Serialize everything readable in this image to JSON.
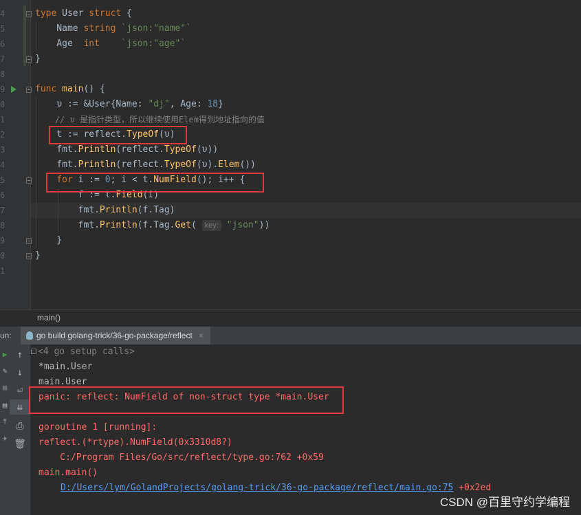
{
  "editor": {
    "line_numbers": [
      "4",
      "5",
      "6",
      "7",
      "8",
      "9",
      "0",
      "1",
      "2",
      "3",
      "4",
      "5",
      "6",
      "7",
      "8",
      "9",
      "0",
      "1"
    ],
    "line1": {
      "kw": "type",
      "name": " User ",
      "kw2": "struct",
      "rest": " {"
    },
    "line2": {
      "field": "    Name ",
      "type": "string",
      "tag": " `json:",
      "tagval": "\"name\"",
      "tagend": "`"
    },
    "line3": {
      "field": "    Age  ",
      "type": "int",
      "tag": "    `json:",
      "tagval": "\"age\"",
      "tagend": "`"
    },
    "line4": "}",
    "line6": {
      "kw": "func",
      "name": " main",
      "rest": "() {"
    },
    "line7": {
      "a": "    υ := &User{Name: ",
      "s": "\"dj\"",
      "b": ", Age: ",
      "n": "18",
      "c": "}"
    },
    "line8": "    // υ 是指针类型，所以继续使用Elem得到地址指向的值",
    "line9": {
      "a": "    t := ",
      "pkg": "reflect.",
      "fn": "TypeOf",
      "b": "(υ)"
    },
    "line10": {
      "a": "    fmt.",
      "fn": "Println",
      "b": "(reflect.",
      "fn2": "TypeOf",
      "c": "(υ))"
    },
    "line11": {
      "a": "    fmt.",
      "fn": "Println",
      "b": "(reflect.",
      "fn2": "TypeOf",
      "c": "(υ).",
      "fn3": "Elem",
      "d": "())"
    },
    "line12": {
      "kw": "    for",
      "a": " i := ",
      "n": "0",
      "b": "; i < t.",
      "fn": "NumField",
      "c": "(); i++ {"
    },
    "line13": {
      "a": "        f := t.",
      "fn": "Field",
      "b": "(i)"
    },
    "line14": {
      "a": "        fmt.",
      "fn": "Println",
      "b": "(f.Tag)"
    },
    "line15": {
      "a": "        fmt.",
      "fn": "Println",
      "b": "(f.Tag.",
      "fn2": "Get",
      "c": "( ",
      "hint": "key:",
      "s": " \"json\"",
      "d": "))"
    },
    "line16": "    }",
    "line17": "}"
  },
  "breadcrumb": "main()",
  "run": {
    "label": "un:",
    "tab_title": "go build golang-trick/36-go-package/reflect",
    "tab_close": "×"
  },
  "console": {
    "setup_calls": "<4 go setup calls>",
    "out1": "*main.User",
    "out2": "main.User",
    "panic": "panic: reflect: NumField of non-struct type *main.User",
    "goroutine": "goroutine 1 [running]:",
    "frame1": "reflect.(*rtype).NumField(0x3310d8?)",
    "frame1_loc": "    C:/Program Files/Go/src/reflect/type.go:762 +0x59",
    "frame2": "main.main()",
    "frame2_link": "D:/Users/lym/GolandProjects/golang-trick/36-go-package/reflect/main.go:75",
    "frame2_off": " +0x2ed"
  },
  "watermark": "CSDN @百里守约学编程",
  "colors": {
    "keyword": "#cc7832",
    "function": "#ffc66d",
    "string": "#6a8759",
    "number": "#6897bb",
    "error": "#ff6b68",
    "link": "#589df6",
    "highlight_box": "#e0383b"
  }
}
